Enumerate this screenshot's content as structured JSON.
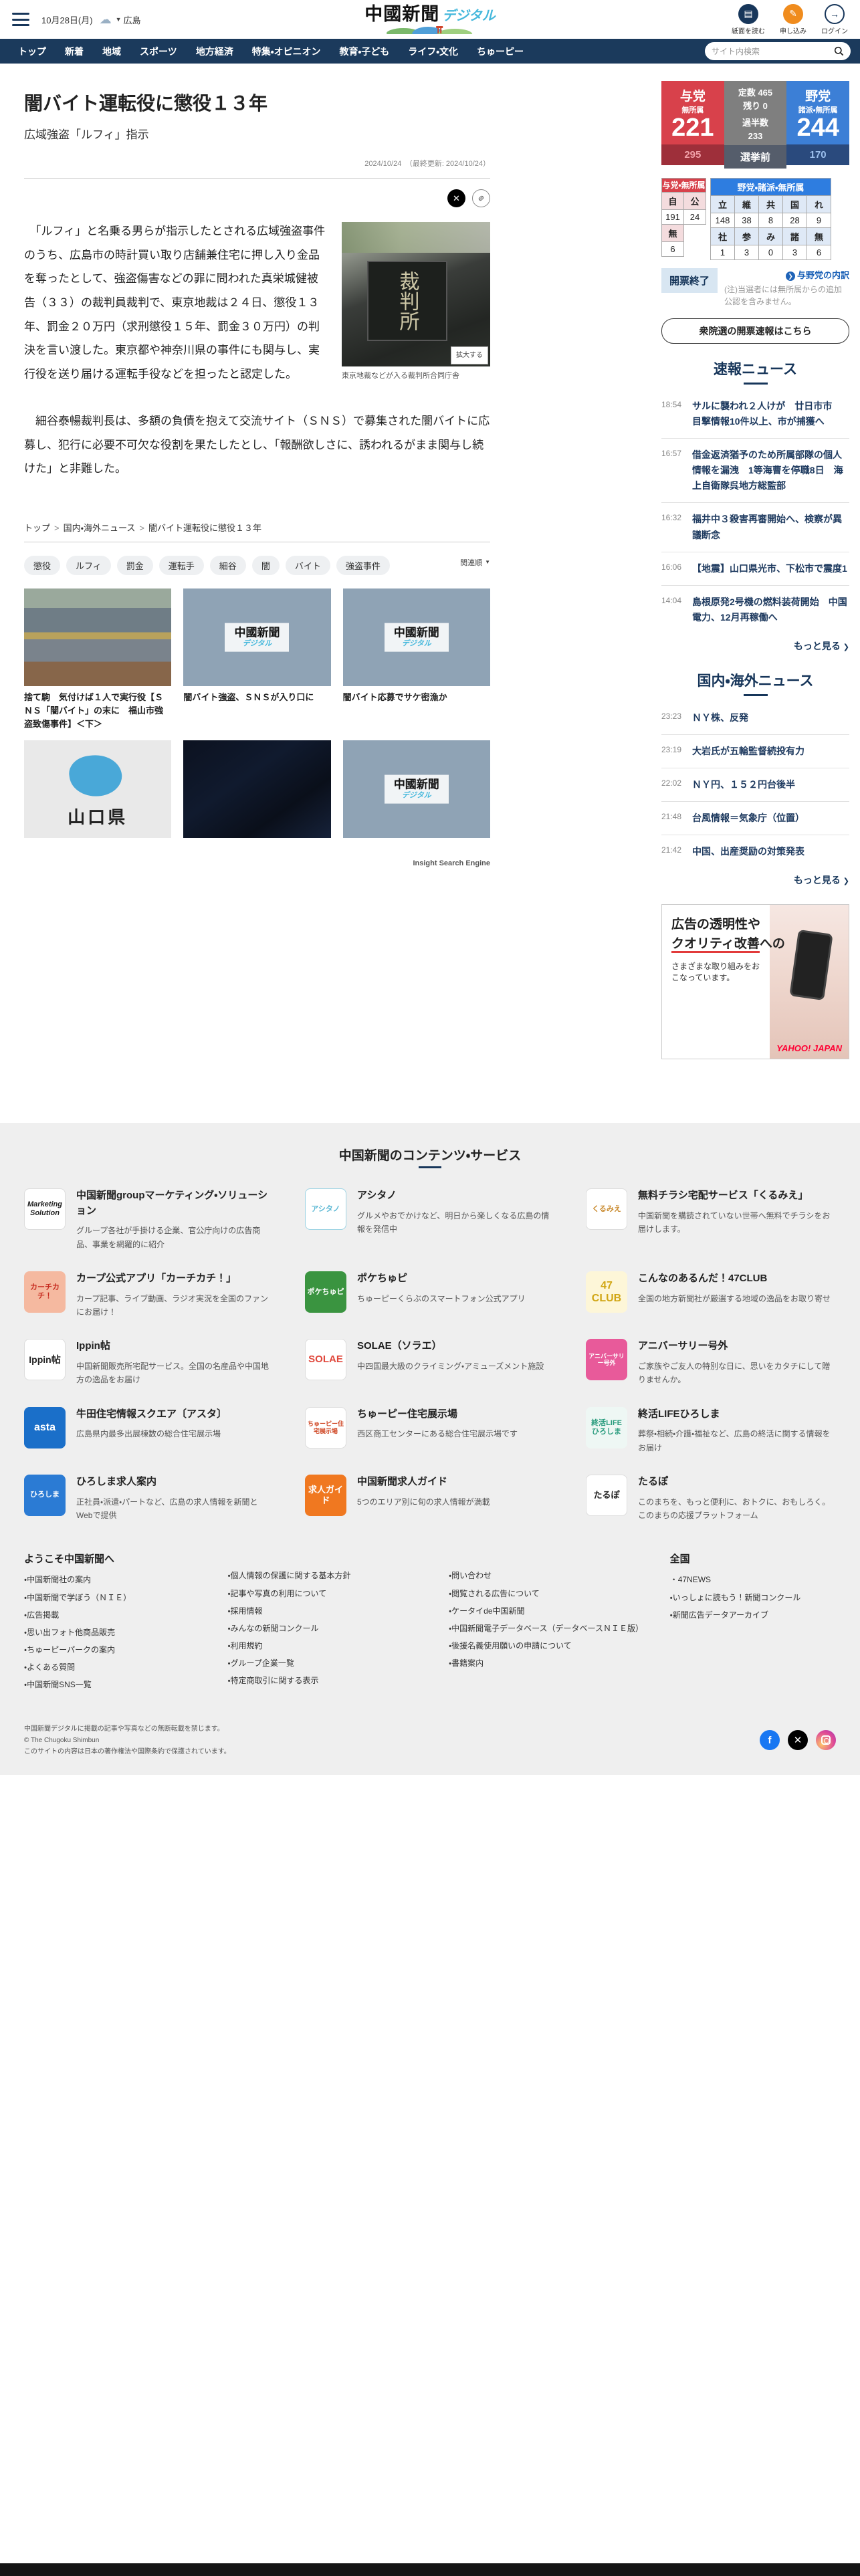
{
  "header": {
    "date": "10月28日(月)",
    "region": "広島",
    "logo_main": "中國新聞",
    "logo_sub": "デジタル",
    "action_read": "紙面を読む",
    "action_apply": "申し込み",
    "action_login": "ログイン"
  },
  "nav": {
    "items": [
      "トップ",
      "新着",
      "地域",
      "スポーツ",
      "地方経済",
      "特集・オピニオン",
      "教育・子ども",
      "ライフ・文化",
      "ちゅーピー"
    ],
    "search_placeholder": "サイト内検索"
  },
  "article": {
    "title": "闇バイト運転役に懲役１３年",
    "subtitle": "広域強盗「ルフィ」指示",
    "date_line": "2024/10/24　（最終更新: 2024/10/24）",
    "paragraph1": "　「ルフィ」と名乗る男らが指示したとされる広域強盗事件のうち、広島市の時計買い取り店舗兼住宅に押し入り金品を奪ったとして、強盗傷害などの罪に問われた真栄城健被告（３３）の裁判員裁判で、東京地裁は２４日、懲役１３年、罰金２０万円（求刑懲役１５年、罰金３０万円）の判決を言い渡した。東京都や神奈川県の事件にも関与し、実行役を送り届ける運転手役などを担ったと認定した。",
    "paragraph2": "　細谷泰暢裁判長は、多額の負債を抱えて交流サイト（ＳＮＳ）で募集された闇バイトに応募し、犯行に必要不可欠な役割を果たしたとし、「報酬欲しさに、誘われるがまま関与し続けた」と非難した。",
    "photo_plate": "裁判所",
    "photo_zoom_label": "拡大する",
    "photo_caption": "東京地裁などが入る裁判所合同庁舎",
    "breadcrumb": [
      "トップ",
      "国内・海外ニュース",
      "闇バイト運転役に懲役１３年"
    ],
    "tags": [
      "懲役",
      "ルフィ",
      "罰金",
      "運転手",
      "細谷",
      "闇",
      "バイト",
      "強盗事件"
    ],
    "sort_label": "関連順",
    "watermark_main": "中國新聞",
    "watermark_sub": "デジタル",
    "map_label": "山口県",
    "related": [
      {
        "caption": "捨て駒　気付けば１人で実行役【ＳＮＳ「闇バイト」の末に　福山市強盗致傷事件】＜下＞"
      },
      {
        "caption": "闇バイト強盗、ＳＮＳが入り口に"
      },
      {
        "caption": "闇バイト応募でサケ密漁か"
      },
      {
        "caption": ""
      },
      {
        "caption": ""
      },
      {
        "caption": ""
      }
    ],
    "related_attribution": "Insight Search Engine"
  },
  "election": {
    "colors": {
      "ruling_red": "#d8414b",
      "opposition_blue": "#3c7fd6",
      "middle_gray": "#7f7f7f"
    },
    "ruling": {
      "name": "与党",
      "sub": "無所属",
      "seats": "221",
      "before": "295"
    },
    "middle": {
      "line1": "定数 465",
      "line2": "残り 0",
      "line3": "過半数",
      "line4": "233",
      "before": "選挙前"
    },
    "opposition": {
      "name": "野党",
      "sub": "諸派・無所属",
      "seats": "244",
      "before": "170"
    },
    "left_table": {
      "header": "与党・無所属",
      "col1": "自",
      "col2": "公",
      "val1": "191",
      "val2": "24",
      "extra_col": "無",
      "extra_val": "6"
    },
    "right_table": {
      "header": "野党・諸派・無所属",
      "r1c": [
        "立",
        "維",
        "共",
        "国",
        "れ"
      ],
      "r1v": [
        "148",
        "38",
        "8",
        "28",
        "9"
      ],
      "r2c": [
        "社",
        "参",
        "み",
        "諸",
        "無"
      ],
      "r2v": [
        "1",
        "3",
        "0",
        "3",
        "6"
      ]
    },
    "status": "開票終了",
    "breakdown_link": "与野党の内訳",
    "note": "(注)当選者には無所属からの追加公認を含みません。",
    "results_button": "衆院選の開票速報はこちら"
  },
  "breaking": {
    "title": "速報ニュース",
    "items": [
      {
        "time": "18:54",
        "title": "サルに襲われ２人けが　廿日市市　目撃情報10件以上、市が捕獲へ"
      },
      {
        "time": "16:57",
        "title": "借金返済猶予のため所属部隊の個人情報を漏洩　1等海曹を停職8日　海上自衛隊呉地方総監部"
      },
      {
        "time": "16:32",
        "title": "福井中３殺害再審開始へ、検察が異議断念"
      },
      {
        "time": "16:06",
        "title": "【地震】山口県光市、下松市で震度1"
      },
      {
        "time": "14:04",
        "title": "島根原発2号機の燃料装荷開始　中国電力、12月再稼働へ"
      }
    ],
    "more": "もっと見る"
  },
  "national": {
    "title": "国内・海外ニュース",
    "items": [
      {
        "time": "23:23",
        "title": "ＮＹ株、反発"
      },
      {
        "time": "23:19",
        "title": "大岩氏が五輪監督続投有力"
      },
      {
        "time": "22:02",
        "title": "ＮＹ円、１５２円台後半"
      },
      {
        "time": "21:48",
        "title": "台風情報＝気象庁（位置）"
      },
      {
        "time": "21:42",
        "title": "中国、出産奨励の対策発表"
      }
    ],
    "more": "もっと見る"
  },
  "ad": {
    "line1": "広告の透明性や",
    "line2": "クオリティ改善",
    "line3": "への",
    "line4": "さまざまな取り組みをおこなっています。",
    "logo": "YAHOO! JAPAN"
  },
  "footer": {
    "services_title": "中国新聞のコンテンツ・サービス",
    "services": [
      {
        "title": "中国新聞groupマーケティング・ソリューション",
        "desc": "グループ各社が手掛ける企業、官公庁向けの広告商品、事業を網羅的に紹介",
        "icon_text": "Marketing Solution",
        "icon_bg": "#ffffff",
        "icon_fg": "#222222"
      },
      {
        "title": "アシタノ",
        "desc": "グルメやおでかけなど、明日から楽しくなる広島の情報を発信中",
        "icon_text": "アシタノ",
        "icon_bg": "#ffffff",
        "icon_fg": "#5bb8d4"
      },
      {
        "title": "無料チラシ宅配サービス「くるみえ」",
        "desc": "中国新聞を購読されていない世帯へ無料でチラシをお届けします。",
        "icon_text": "くるみえ",
        "icon_bg": "#ffffff",
        "icon_fg": "#c98a2e"
      },
      {
        "title": "カープ公式アプリ「カーチカチ！」",
        "desc": "カープ記事、ライブ動画、ラジオ実況を全国のファンにお届け！",
        "icon_text": "カーチカチ！",
        "icon_bg": "#f5b9a0",
        "icon_fg": "#c62a1e"
      },
      {
        "title": "ポケちゅピ",
        "desc": "ちゅーピーくらぶのスマートフォン公式アプリ",
        "icon_text": "ポケちゅピ",
        "icon_bg": "#3a9440",
        "icon_fg": "#ffffff"
      },
      {
        "title": "こんなのあるんだ！47CLUB",
        "desc": "全国の地方新聞社が厳選する地域の逸品をお取り寄せ",
        "icon_text": "47 CLUB",
        "icon_bg": "#fdf6d8",
        "icon_fg": "#d1a614"
      },
      {
        "title": "Ippin帖",
        "desc": "中国新聞販売所宅配サービス。全国の名産品や中国地方の逸品をお届け",
        "icon_text": "Ippin帖",
        "icon_bg": "#ffffff",
        "icon_fg": "#222222"
      },
      {
        "title": "SOLAE（ソラエ）",
        "desc": "中四国最大級のクライミング・アミューズメント施設",
        "icon_text": "SOLAE",
        "icon_bg": "#ffffff",
        "icon_fg": "#e0483c"
      },
      {
        "title": "アニバーサリー号外",
        "desc": "ご家族やご友人の特別な日に、思いをカタチにして贈りませんか。",
        "icon_text": "アニバーサリー号外",
        "icon_bg": "#e85a9a",
        "icon_fg": "#ffffff"
      },
      {
        "title": "牛田住宅情報スクエア〔アスタ〕",
        "desc": "広島県内最多出展棟数の総合住宅展示場",
        "icon_text": "asta",
        "icon_bg": "#1a6fc9",
        "icon_fg": "#ffffff"
      },
      {
        "title": "ちゅーピー住宅展示場",
        "desc": "西区商工センターにある総合住宅展示場です",
        "icon_text": "ちゅーピー住宅展示場",
        "icon_bg": "#ffffff",
        "icon_fg": "#d04a28"
      },
      {
        "title": "終活LIFEひろしま",
        "desc": "葬祭・相続・介護・福祉など、広島の終活に関する情報をお届け",
        "icon_text": "終活LIFE ひろしま",
        "icon_bg": "#eef7f4",
        "icon_fg": "#2a9c7e"
      },
      {
        "title": "ひろしま求人案内",
        "desc": "正社員・派遣・パートなど、広島の求人情報を新聞とWebで提供",
        "icon_text": "ひろしま",
        "icon_bg": "#2b7bd4",
        "icon_fg": "#ffffff"
      },
      {
        "title": "中国新聞求人ガイド",
        "desc": "5つのエリア別に旬の求人情報が満載",
        "icon_text": "求人ガイド",
        "icon_bg": "#f07820",
        "icon_fg": "#ffffff"
      },
      {
        "title": "たるぽ",
        "desc": "このまちを、もっと便利に、おトクに、おもしろく。このまちの応援プラットフォーム",
        "icon_text": "たるぽ",
        "icon_bg": "#ffffff",
        "icon_fg": "#222222"
      }
    ],
    "welcome_title": "ようこそ中国新聞へ",
    "zenkoku_title": "全国",
    "col1": [
      "中国新聞社の案内",
      "中国新聞で学ぼう（ＮＩＥ）",
      "広告掲載",
      "思い出フォト他商品販売",
      "ちゅーピーパークの案内",
      "よくある質問",
      "中国新聞SNS一覧"
    ],
    "col2": [
      "個人情報の保護に関する基本方針",
      "記事や写真の利用について",
      "採用情報",
      "みんなの新聞コンクール",
      "利用規約",
      "グループ企業一覧",
      "特定商取引に関する表示"
    ],
    "col3": [
      "問い合わせ",
      "閲覧される広告について",
      "ケータイde中国新聞",
      "中国新聞電子データベース（データベースＮＩＥ版）",
      "後援名義使用願いの申請について",
      "書籍案内"
    ],
    "col4": [
      "47NEWS",
      "いっしょに読もう！新聞コンクール",
      "新聞広告データアーカイブ"
    ],
    "copyright1": "中国新聞デジタルに掲載の記事や写真などの無断転載を禁じます。",
    "copyright2": "© The Chugoku Shimbun",
    "copyright3": "このサイトの内容は日本の著作権法や国際条約で保護されています。"
  }
}
